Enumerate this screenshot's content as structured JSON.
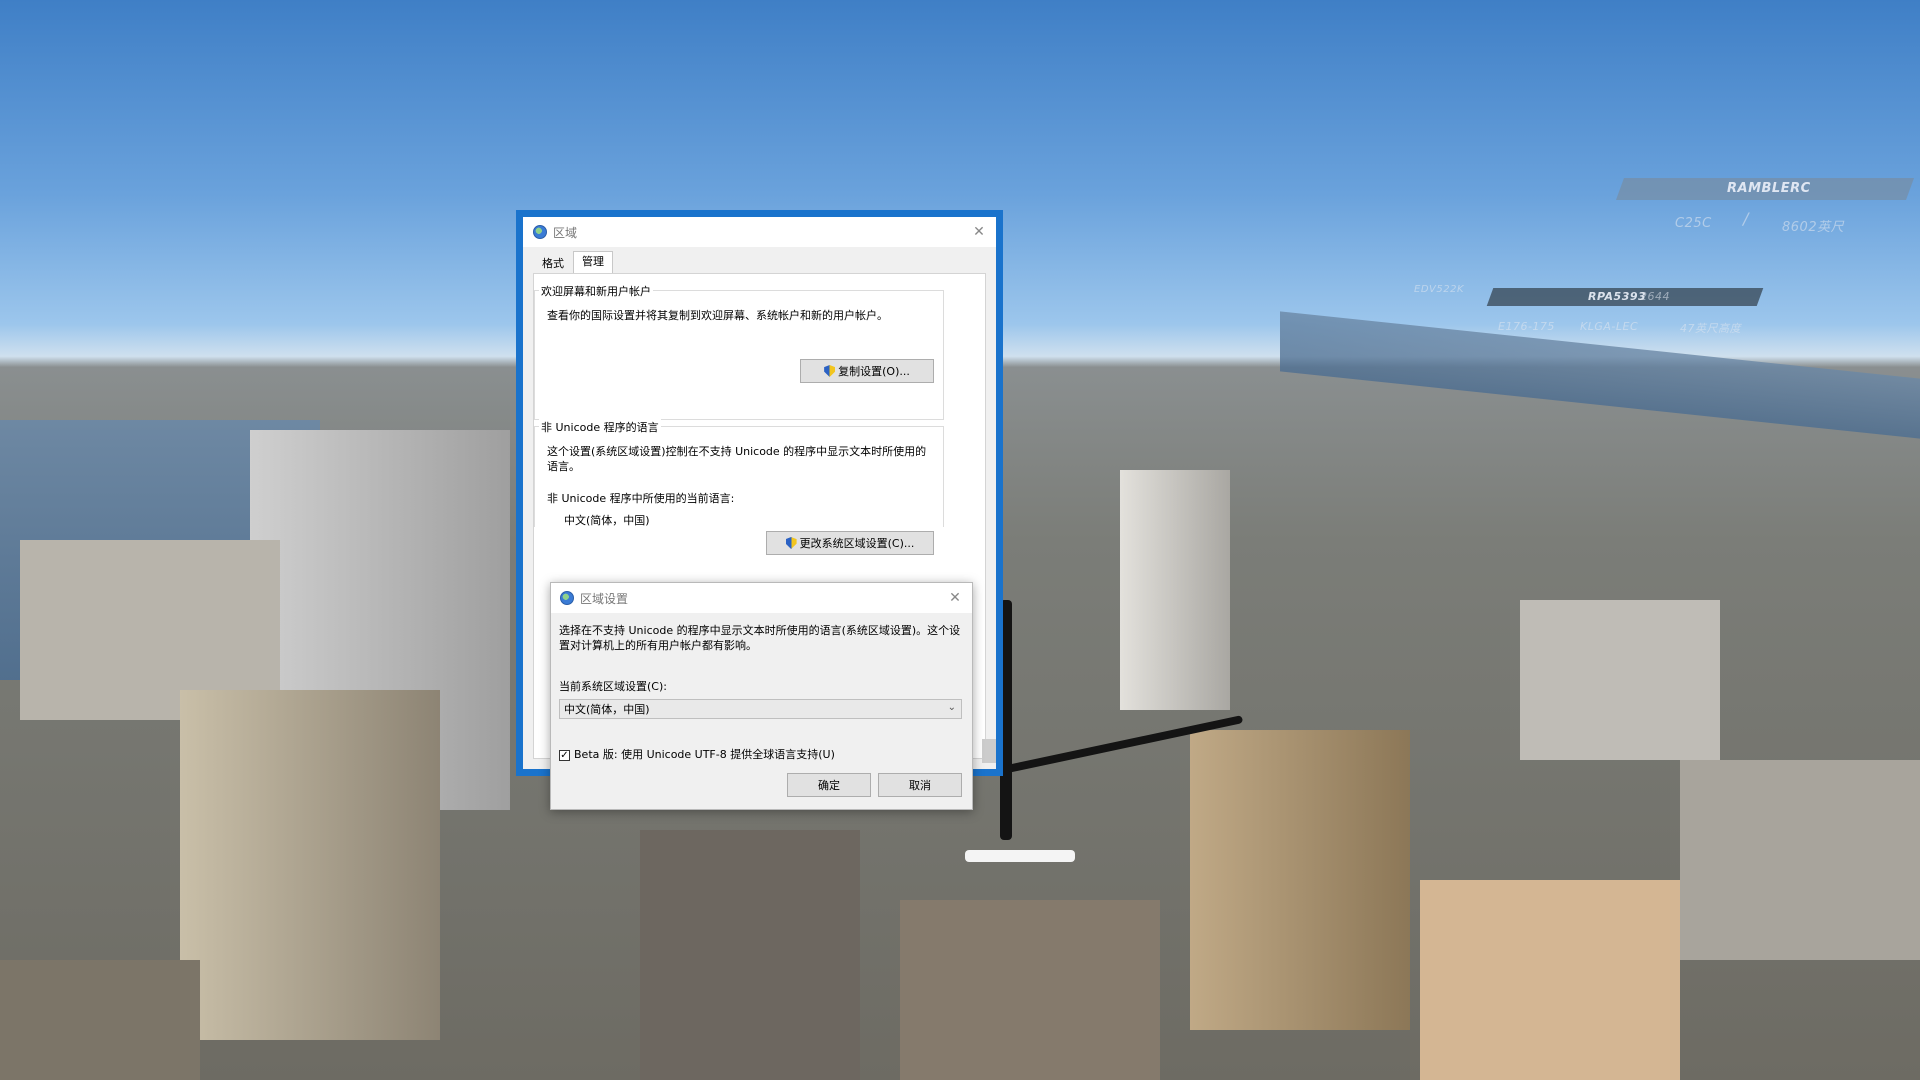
{
  "hud": {
    "top_banner": "RAMBLERC",
    "sub_left": "C25C",
    "sub_right": "8602英尺",
    "label_small": "EDV522K",
    "banner_two": "RPA5393",
    "banner_two_ghost": "2644",
    "row_a": "E176-175",
    "row_b": "KLGA-LEC",
    "row_c": "47英尺高度"
  },
  "region_dialog": {
    "title": "区域",
    "tabs": [
      {
        "label": "格式",
        "active": false
      },
      {
        "label": "管理",
        "active": true
      }
    ],
    "welcome_group": {
      "legend": "欢迎屏幕和新用户帐户",
      "description": "查看你的国际设置并将其复制到欢迎屏幕、系统帐户和新的用户帐户。",
      "button": "复制设置(O)..."
    },
    "unicode_group": {
      "legend": "非 Unicode 程序的语言",
      "description": "这个设置(系统区域设置)控制在不支持 Unicode 的程序中显示文本时所使用的语言。",
      "current_label": "非 Unicode 程序中所使用的当前语言:",
      "current_value": "中文(简体，中国)",
      "button": "更改系统区域设置(C)..."
    }
  },
  "locale_dialog": {
    "title": "区域设置",
    "description": "选择在不支持 Unicode 的程序中显示文本时所使用的语言(系统区域设置)。这个设置对计算机上的所有用户帐户都有影响。",
    "select_label": "当前系统区域设置(C):",
    "select_value": "中文(简体，中国)",
    "beta_checkbox": {
      "label": "Beta 版: 使用 Unicode UTF-8 提供全球语言支持(U)",
      "checked": true
    },
    "ok": "确定",
    "cancel": "取消"
  },
  "icons": {
    "globe": "globe-icon",
    "shield": "uac-shield-icon",
    "close": "close-icon",
    "chevron": "chevron-down-icon",
    "check": "checkmark-icon"
  },
  "colors": {
    "window_accent": "#1a73cc",
    "dialog_bg": "#f0f0f0"
  }
}
